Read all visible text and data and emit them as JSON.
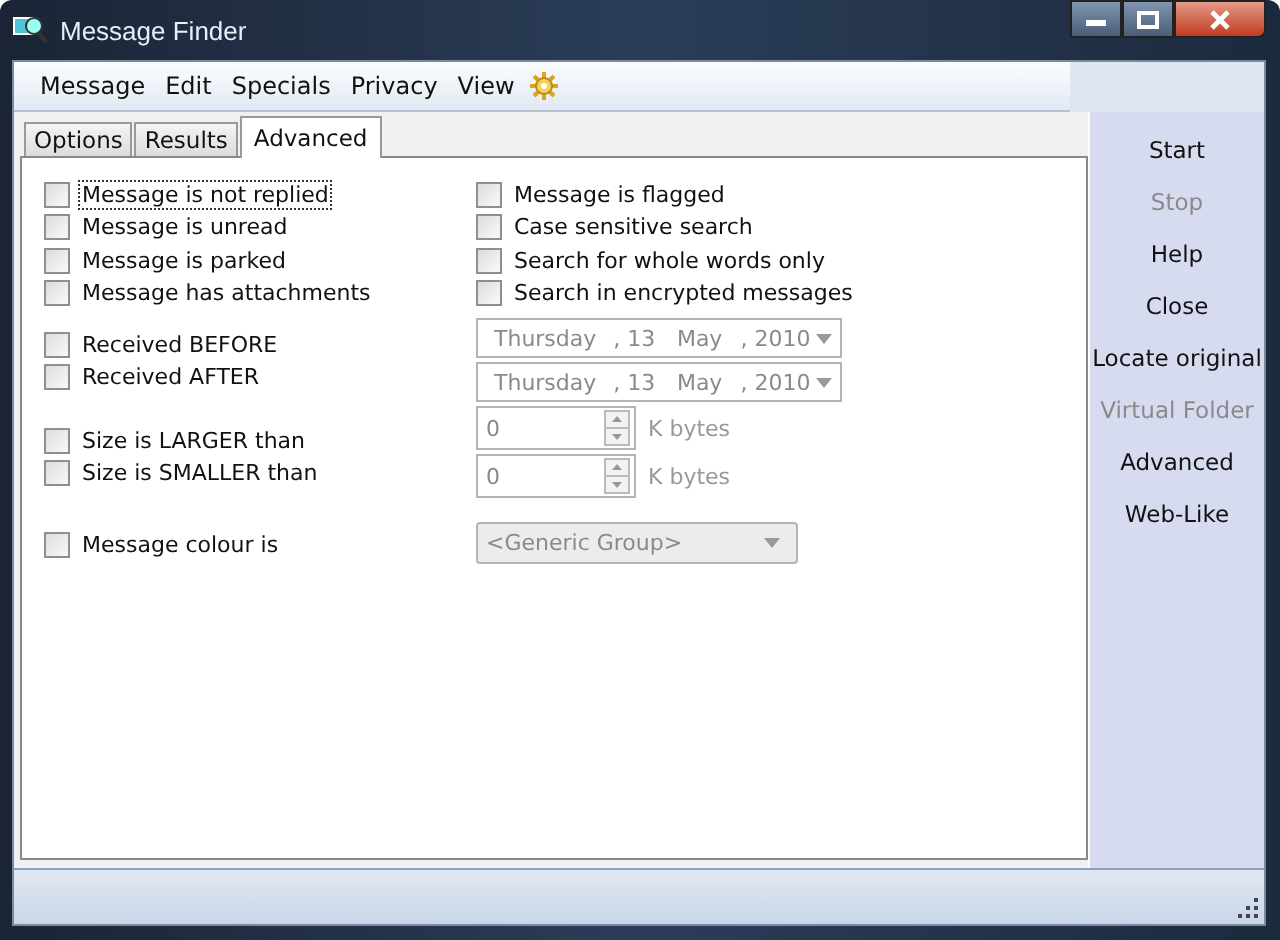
{
  "window": {
    "title": "Message Finder"
  },
  "menu": [
    {
      "label": "Message"
    },
    {
      "label": "Edit"
    },
    {
      "label": "Specials"
    },
    {
      "label": "Privacy"
    },
    {
      "label": "View"
    }
  ],
  "tabs": [
    {
      "label": "Options",
      "selected": false
    },
    {
      "label": "Results",
      "selected": false
    },
    {
      "label": "Advanced",
      "selected": true
    }
  ],
  "left_groups": [
    [
      {
        "kind": "checkbox",
        "label": "Message is not replied",
        "checked": false,
        "focused": true
      },
      {
        "kind": "checkbox",
        "label": "Message is unread",
        "checked": false,
        "focused": false
      },
      {
        "kind": "checkbox",
        "label": "Message is parked",
        "checked": false,
        "focused": false
      },
      {
        "kind": "checkbox",
        "label": "Message has attachments",
        "checked": false,
        "focused": false
      }
    ],
    [
      {
        "kind": "checkbox",
        "label": "Received BEFORE",
        "checked": false,
        "focused": false
      },
      {
        "kind": "checkbox",
        "label": "Received AFTER",
        "checked": false,
        "focused": false
      }
    ],
    [
      {
        "kind": "checkbox",
        "label": "Size is LARGER than",
        "checked": false,
        "focused": false
      },
      {
        "kind": "checkbox",
        "label": "Size is SMALLER than",
        "checked": false,
        "focused": false
      }
    ],
    [
      {
        "kind": "checkbox",
        "label": "Message colour is",
        "checked": false,
        "focused": false
      }
    ]
  ],
  "right_groups": [
    [
      {
        "kind": "checkbox",
        "label": "Message is flagged",
        "checked": false,
        "focused": false
      },
      {
        "kind": "checkbox",
        "label": "Case sensitive search",
        "checked": false,
        "focused": false
      },
      {
        "kind": "checkbox",
        "label": "Search for whole words only",
        "checked": false,
        "focused": false
      },
      {
        "kind": "checkbox",
        "label": "Search in encrypted messages",
        "checked": false,
        "focused": false
      }
    ],
    [
      {
        "kind": "date",
        "weekday": "Thursday",
        "day": ", 13",
        "month": "May",
        "year": ", 2010",
        "disabled": true
      },
      {
        "kind": "date",
        "weekday": "Thursday",
        "day": ", 13",
        "month": "May",
        "year": ", 2010",
        "disabled": true
      }
    ],
    [
      {
        "kind": "spin",
        "value": "0",
        "unit": "K bytes",
        "disabled": true
      },
      {
        "kind": "spin",
        "value": "0",
        "unit": "K bytes",
        "disabled": true
      }
    ],
    [
      {
        "kind": "select",
        "value": "<Generic Group>",
        "disabled": true
      }
    ]
  ],
  "sidebar": [
    {
      "label": "Start",
      "disabled": false
    },
    {
      "label": "Stop",
      "disabled": true
    },
    {
      "label": "Help",
      "disabled": false
    },
    {
      "label": "Close",
      "disabled": false
    },
    {
      "label": "Locate original",
      "disabled": false
    },
    {
      "label": "Virtual Folder",
      "disabled": true
    },
    {
      "label": "Advanced",
      "disabled": false
    },
    {
      "label": "Web-Like",
      "disabled": false
    }
  ]
}
